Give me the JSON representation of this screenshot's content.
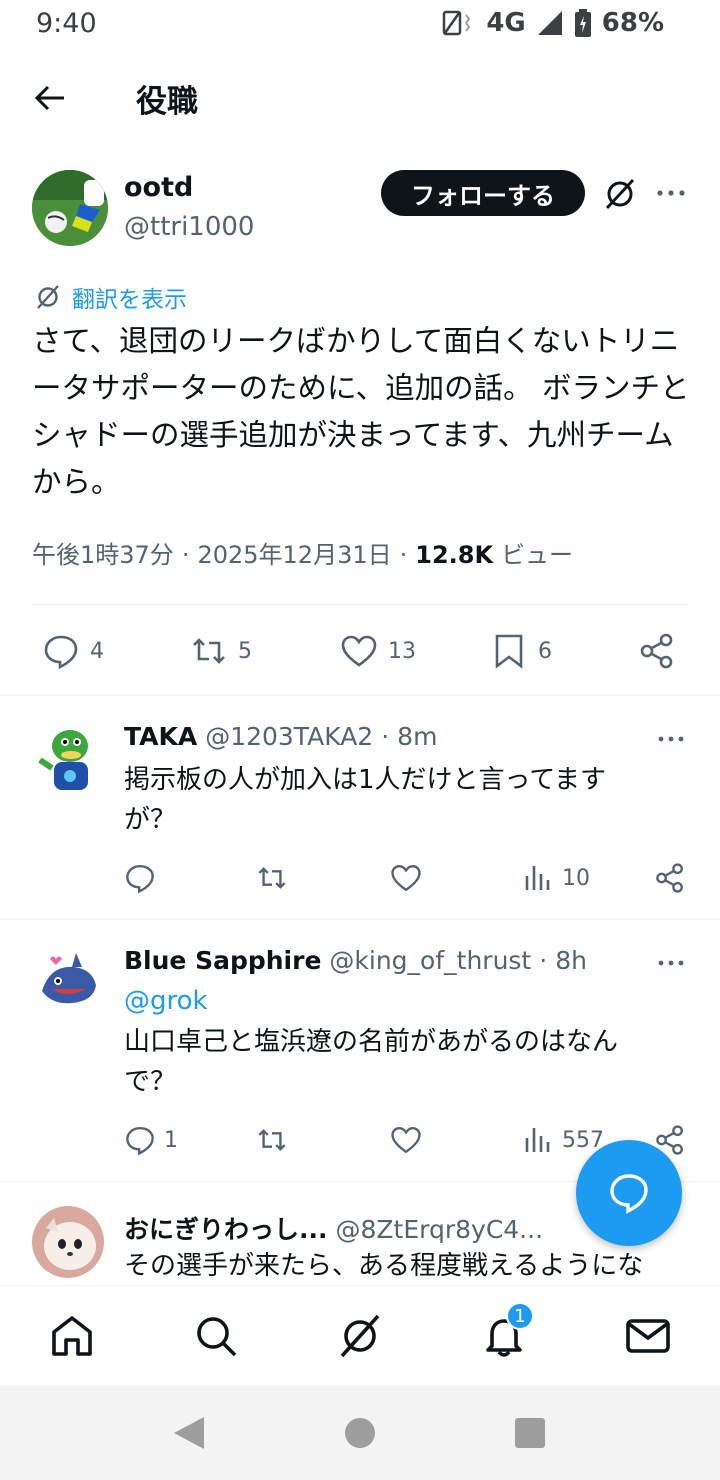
{
  "status_bar": {
    "time": "9:40",
    "network": "4G",
    "battery": "68%"
  },
  "header": {
    "title": "役職"
  },
  "tweet": {
    "display_name": "ootd",
    "handle": "@ttri1000",
    "follow_label": "フォローする",
    "translate_label": "翻訳を表示",
    "text": "さて、退団のリークばかりして面白くないトリニータサポーターのために、追加の話。 ボランチとシャドーの選手追加が決まってます、九州チームから。",
    "time": "午後1時37分",
    "date": "2025年12月31日",
    "views_count": "12.8K",
    "views_label": "ビュー",
    "replies": "4",
    "retweets": "5",
    "likes": "13",
    "bookmarks": "6"
  },
  "replies": [
    {
      "display_name": "TAKA",
      "handle": "@1203TAKA2",
      "time": "8m",
      "mention": "",
      "text": "掲示板の人が加入は1人だけと言ってますが？",
      "replies": "",
      "views": "10"
    },
    {
      "display_name": "Blue Sapphire",
      "handle": "@king_of_thrust",
      "time": "8h",
      "mention": "@grok",
      "text": "山口卓己と塩浜遼の名前があがるのはなんで？",
      "replies": "1",
      "views": "557"
    },
    {
      "display_name": "おにぎりわっし...",
      "handle": "@8ZtErqr8yC4...",
      "time": "",
      "mention": "",
      "text": "その選手が来たら、ある程度戦えるようにな",
      "replies": "",
      "views": ""
    }
  ],
  "bottom_nav": {
    "notifications_badge": "1"
  },
  "colors": {
    "accent": "#1d9bf0",
    "text": "#0f1419",
    "secondary": "#536471"
  }
}
